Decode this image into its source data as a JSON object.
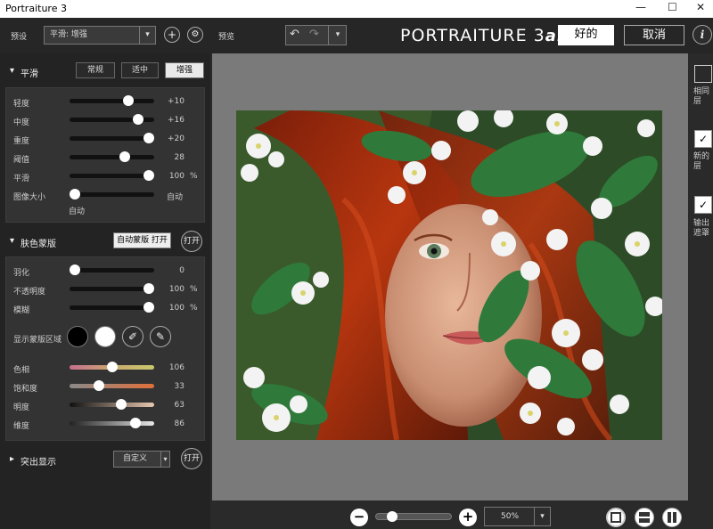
{
  "window": {
    "title": "Portraiture 3",
    "minimize": "—",
    "maximize": "☐",
    "close": "✕"
  },
  "topbar": {
    "preset_label": "预设",
    "preset_value": "平滑: 增强",
    "preview_label": "预览",
    "logo_main": "PORTRAITURE 3",
    "logo_ai": "ai",
    "ok_label": "好的",
    "cancel_label": "取消",
    "info_label": "i"
  },
  "smoothing": {
    "title": "平滑",
    "tabs": [
      "常规",
      "适中",
      "增强"
    ],
    "active_tab": 2,
    "sliders": [
      {
        "label": "轻度",
        "value": "+10",
        "level": 0.72
      },
      {
        "label": "中度",
        "value": "+16",
        "level": 0.86
      },
      {
        "label": "重度",
        "value": "+20",
        "level": 1.0
      },
      {
        "label": "阈值",
        "value": "28",
        "level": 0.68
      },
      {
        "label": "平滑",
        "value": "100",
        "unit": "%",
        "level": 1.0
      }
    ],
    "portrait_size_label": "图像大小",
    "portrait_size_value": "自动",
    "portrait_size_sub": "自动"
  },
  "skin_mask": {
    "title": "肤色蒙版",
    "auto_mask_label": "自动蒙版 打开",
    "open_label": "打开",
    "sliders": [
      {
        "label": "羽化",
        "value": "0",
        "level": 0.0
      },
      {
        "label": "不透明度",
        "value": "100",
        "unit": "%",
        "level": 1.0
      },
      {
        "label": "模糊",
        "value": "100",
        "unit": "%",
        "level": 1.0
      }
    ],
    "show_mask_label": "显示蒙版区域",
    "color_sliders": [
      {
        "label": "色相",
        "value": "106",
        "level": 0.5
      },
      {
        "label": "饱和度",
        "value": "33",
        "level": 0.33
      },
      {
        "label": "明度",
        "value": "63",
        "level": 0.63
      },
      {
        "label": "维度",
        "value": "86",
        "level": 0.82
      }
    ]
  },
  "enhance": {
    "title": "突出显示",
    "dropdown_value": "自定义",
    "open_label": "打开"
  },
  "rightstrip": {
    "items": [
      "相同层",
      "新的层",
      "输出遮罩"
    ]
  },
  "zoom": {
    "value": "50%",
    "level": 0.17
  },
  "colors": {
    "accent_white": "#ffffff",
    "panel_bg": "#333333",
    "preview_bg": "#7a7a7a"
  }
}
